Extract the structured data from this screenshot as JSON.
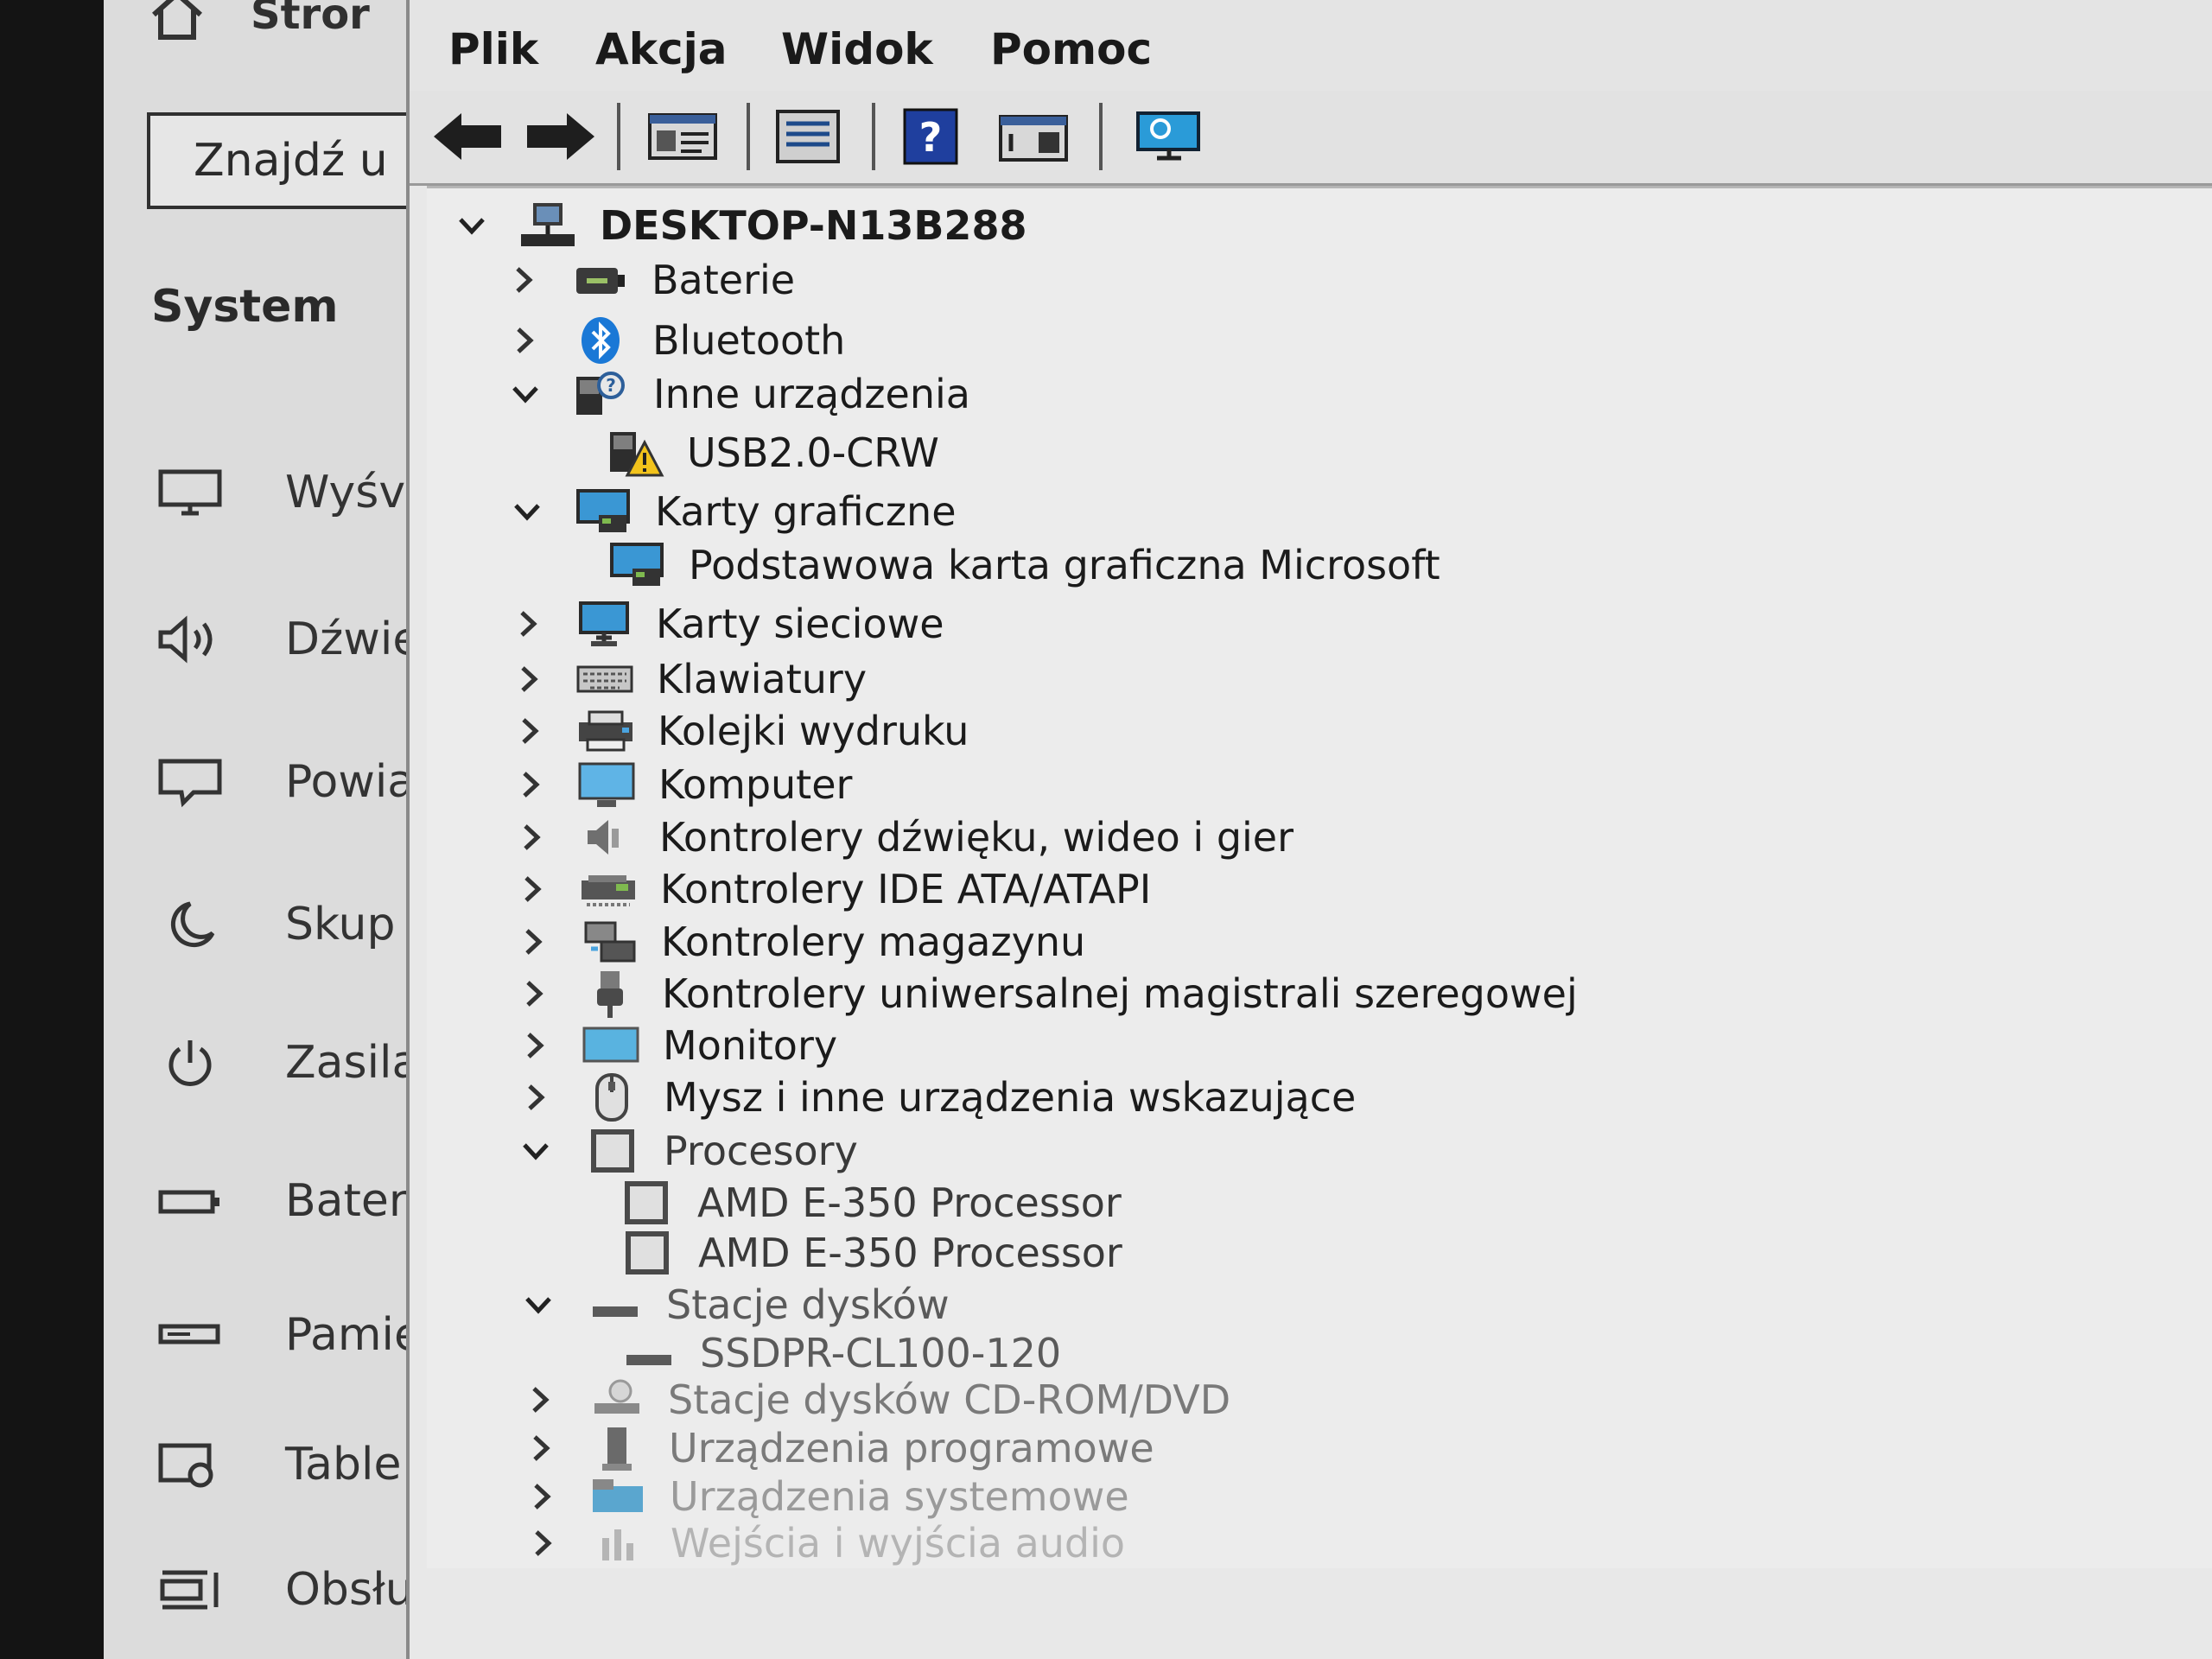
{
  "settings": {
    "home_label": "Stror",
    "search_placeholder": "Znajdź u",
    "section_title": "System",
    "nav": [
      {
        "label": "Wyśv",
        "icon": "display-icon"
      },
      {
        "label": "Dźwię",
        "icon": "speaker-icon"
      },
      {
        "label": "Powia",
        "icon": "notification-icon"
      },
      {
        "label": "Skup",
        "icon": "focus-assist-icon"
      },
      {
        "label": "Zasila",
        "icon": "power-icon"
      },
      {
        "label": "Bater",
        "icon": "battery-icon"
      },
      {
        "label": "Pamię",
        "icon": "storage-icon"
      },
      {
        "label": "Table",
        "icon": "tablet-icon"
      },
      {
        "label": "Obsłu",
        "icon": "multitasking-icon"
      }
    ]
  },
  "device_manager": {
    "menu": [
      "Plik",
      "Akcja",
      "Widok",
      "Pomoc"
    ],
    "toolbar": [
      "back-icon",
      "forward-icon",
      "properties-icon",
      "update-driver-icon",
      "help-icon",
      "show-hidden-icon",
      "scan-hardware-icon"
    ],
    "tree": {
      "root": "DESKTOP-N13B288",
      "items": [
        {
          "label": "Baterie",
          "expanded": false,
          "icon": "battery-category-icon"
        },
        {
          "label": "Bluetooth",
          "expanded": false,
          "icon": "bluetooth-icon"
        },
        {
          "label": "Inne urządzenia",
          "expanded": true,
          "icon": "other-devices-icon"
        },
        {
          "label": "USB2.0-CRW",
          "child": true,
          "icon": "warning-device-icon"
        },
        {
          "label": "Karty graficzne",
          "expanded": true,
          "icon": "display-adapter-icon"
        },
        {
          "label": "Podstawowa karta graficzna Microsoft",
          "child": true,
          "icon": "display-adapter-icon"
        },
        {
          "label": "Karty sieciowe",
          "expanded": false,
          "icon": "network-adapter-icon"
        },
        {
          "label": "Klawiatury",
          "expanded": false,
          "icon": "keyboard-icon"
        },
        {
          "label": "Kolejki wydruku",
          "expanded": false,
          "icon": "printer-icon"
        },
        {
          "label": "Komputer",
          "expanded": false,
          "icon": "computer-icon"
        },
        {
          "label": "Kontrolery dźwięku, wideo i gier",
          "expanded": false,
          "icon": "sound-icon"
        },
        {
          "label": "Kontrolery IDE ATA/ATAPI",
          "expanded": false,
          "icon": "ide-controller-icon"
        },
        {
          "label": "Kontrolery magazynu",
          "expanded": false,
          "icon": "storage-controller-icon"
        },
        {
          "label": "Kontrolery uniwersalnej magistrali szeregowej",
          "expanded": false,
          "icon": "usb-icon"
        },
        {
          "label": "Monitory",
          "expanded": false,
          "icon": "monitor-icon"
        },
        {
          "label": "Mysz i inne urządzenia wskazujące",
          "expanded": false,
          "icon": "mouse-icon"
        },
        {
          "label": "Procesory",
          "expanded": true,
          "icon": "processor-icon"
        },
        {
          "label": "AMD E-350 Processor",
          "child": true,
          "icon": "processor-icon"
        },
        {
          "label": "AMD E-350 Processor",
          "child": true,
          "icon": "processor-icon"
        },
        {
          "label": "Stacje dysków",
          "expanded": true,
          "icon": "disk-drive-icon"
        },
        {
          "label": "SSDPR-CL100-120",
          "child": true,
          "icon": "disk-drive-icon"
        },
        {
          "label": "Stacje dysków CD-ROM/DVD",
          "expanded": false,
          "icon": "cdrom-icon"
        },
        {
          "label": "Urządzenia programowe",
          "expanded": false,
          "icon": "software-device-icon"
        },
        {
          "label": "Urządzenia systemowe",
          "expanded": false,
          "icon": "system-devices-icon"
        },
        {
          "label": "Wejścia i wyjścia audio",
          "expanded": false,
          "icon": "audio-io-icon"
        }
      ]
    }
  }
}
